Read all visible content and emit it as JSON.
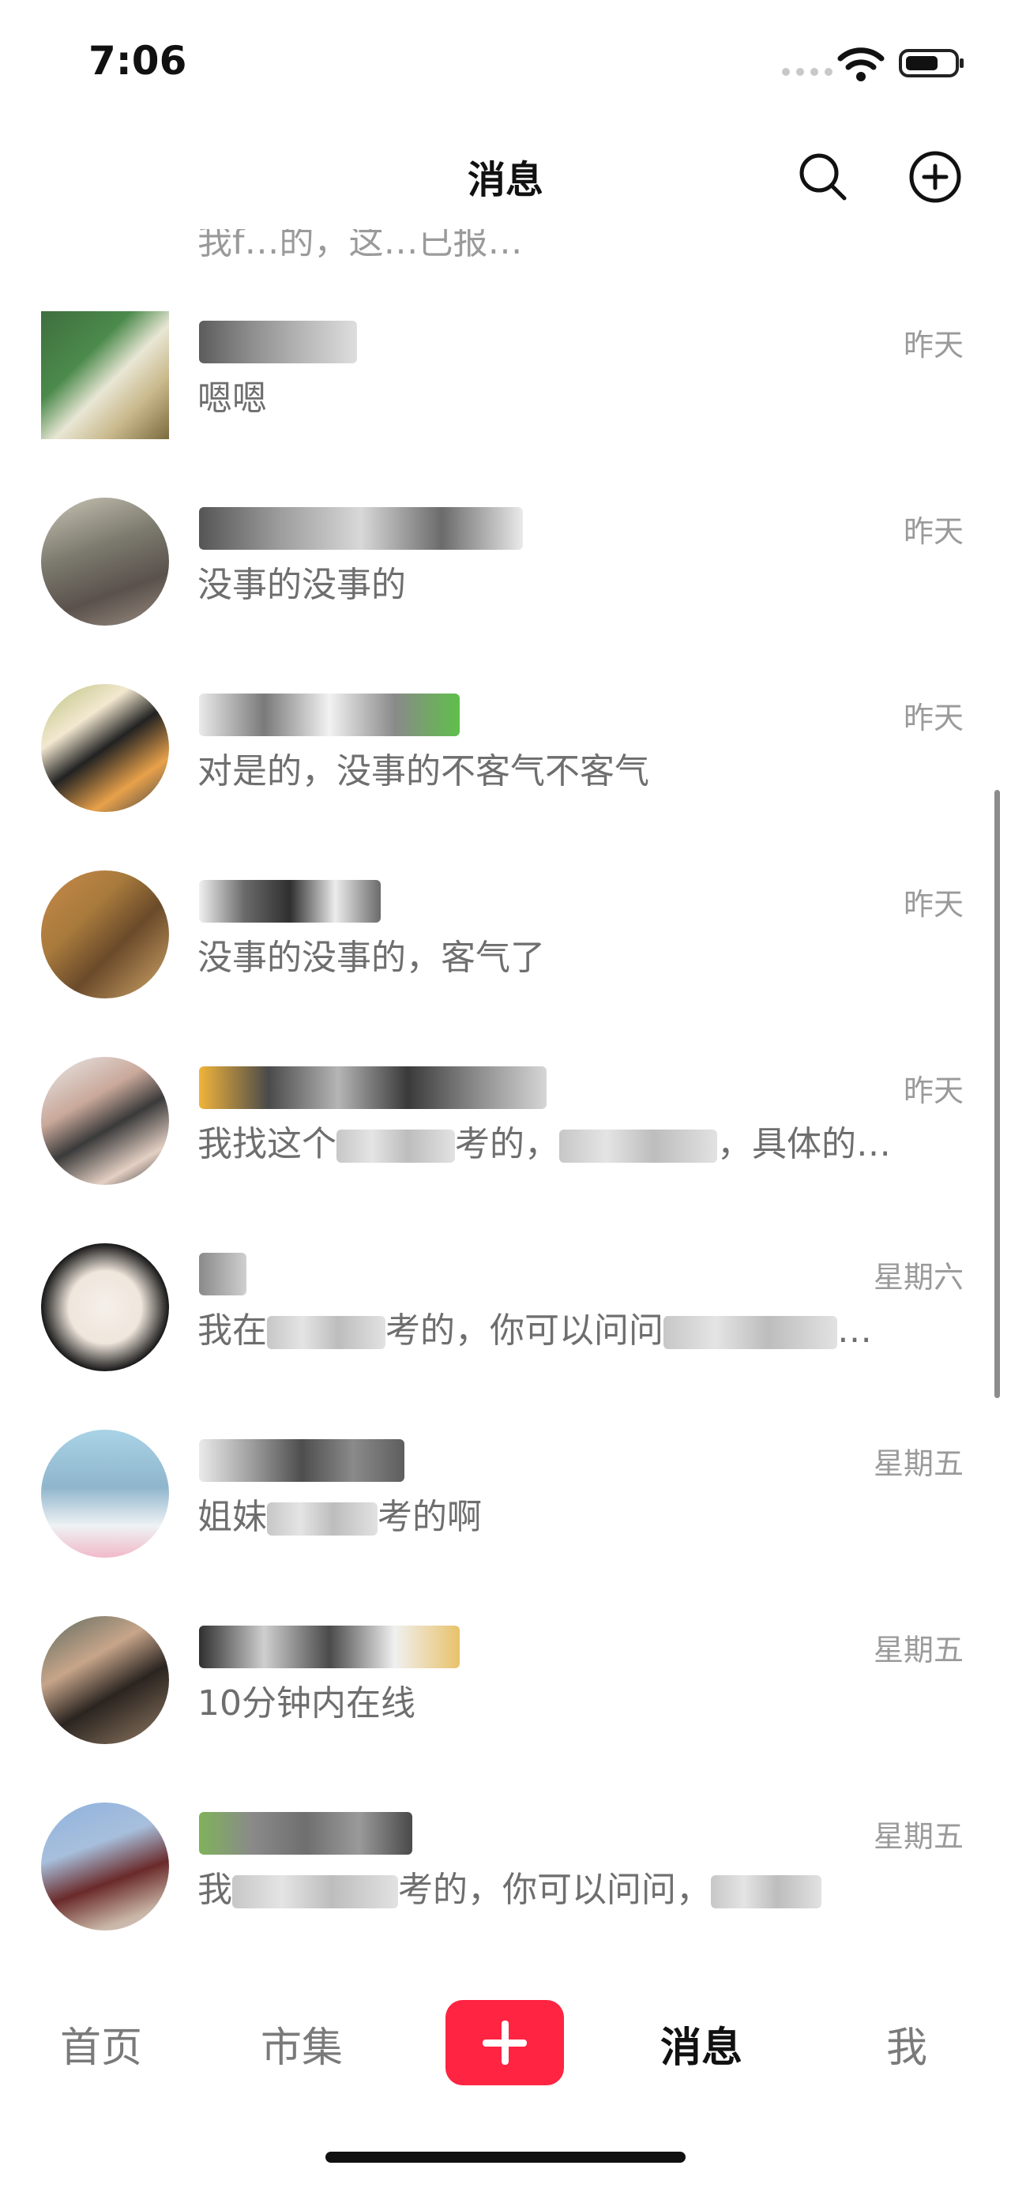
{
  "status_bar": {
    "time": "7:06"
  },
  "header": {
    "title": "消息"
  },
  "partial_row": {
    "preview": "我f…的，这…已报…"
  },
  "conversations": [
    {
      "time": "昨天",
      "preview": "嗯嗯"
    },
    {
      "time": "昨天",
      "preview": "没事的没事的"
    },
    {
      "time": "昨天",
      "preview": "对是的，没事的不客气不客气"
    },
    {
      "time": "昨天",
      "preview": "没事的没事的，客气了"
    },
    {
      "time": "昨天",
      "preview_a": "我找这个",
      "preview_b": "考的，",
      "preview_c": "，具体的…"
    },
    {
      "time": "星期六",
      "preview_a": "我在",
      "preview_b": "考的，你可以问问",
      "preview_c": "…"
    },
    {
      "time": "星期五",
      "preview_a": "姐妹",
      "preview_b": "考的啊"
    },
    {
      "time": "星期五",
      "preview": "10分钟内在线"
    },
    {
      "time": "星期五",
      "preview_a": "我",
      "preview_b": "考的，你可以问问，"
    }
  ],
  "tabbar": {
    "home": "首页",
    "market": "市集",
    "messages": "消息",
    "me": "我"
  },
  "colors": {
    "accent": "#ff2442",
    "muted": "#9a9a9a"
  }
}
